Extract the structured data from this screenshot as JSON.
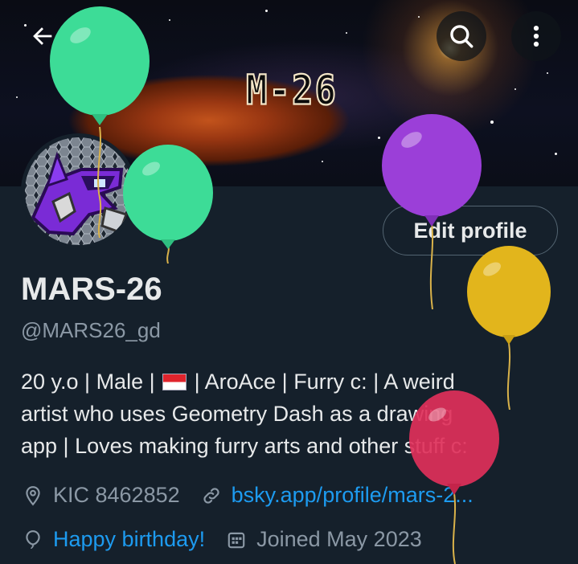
{
  "header": {
    "back_icon": "back-arrow-icon",
    "search_icon": "search-icon",
    "more_icon": "more-vertical-icon",
    "banner_text": "M-26"
  },
  "profile": {
    "display_name": "MARS-26",
    "handle": "@MARS26_gd",
    "edit_button_label": "Edit profile",
    "bio_line1_a": "20 y.o | Male | ",
    "bio_line1_b": " | AroAce | Furry c: | A weird",
    "bio_line2": "artist who uses Geometry Dash as a drawing",
    "bio_line3": "app | Loves making furry arts and other stuff c:",
    "location": "KIC 8462852",
    "website": "bsky.app/profile/mars-2...",
    "birthday": "Happy birthday!",
    "joined": "Joined May 2023"
  },
  "colors": {
    "background": "#15202b",
    "link": "#1d9bf0",
    "muted": "#8b98a5",
    "balloon_green": "#3ddc97",
    "balloon_purple": "#9b3fd8",
    "balloon_yellow": "#e2b51c",
    "balloon_pink": "#e0305a"
  }
}
